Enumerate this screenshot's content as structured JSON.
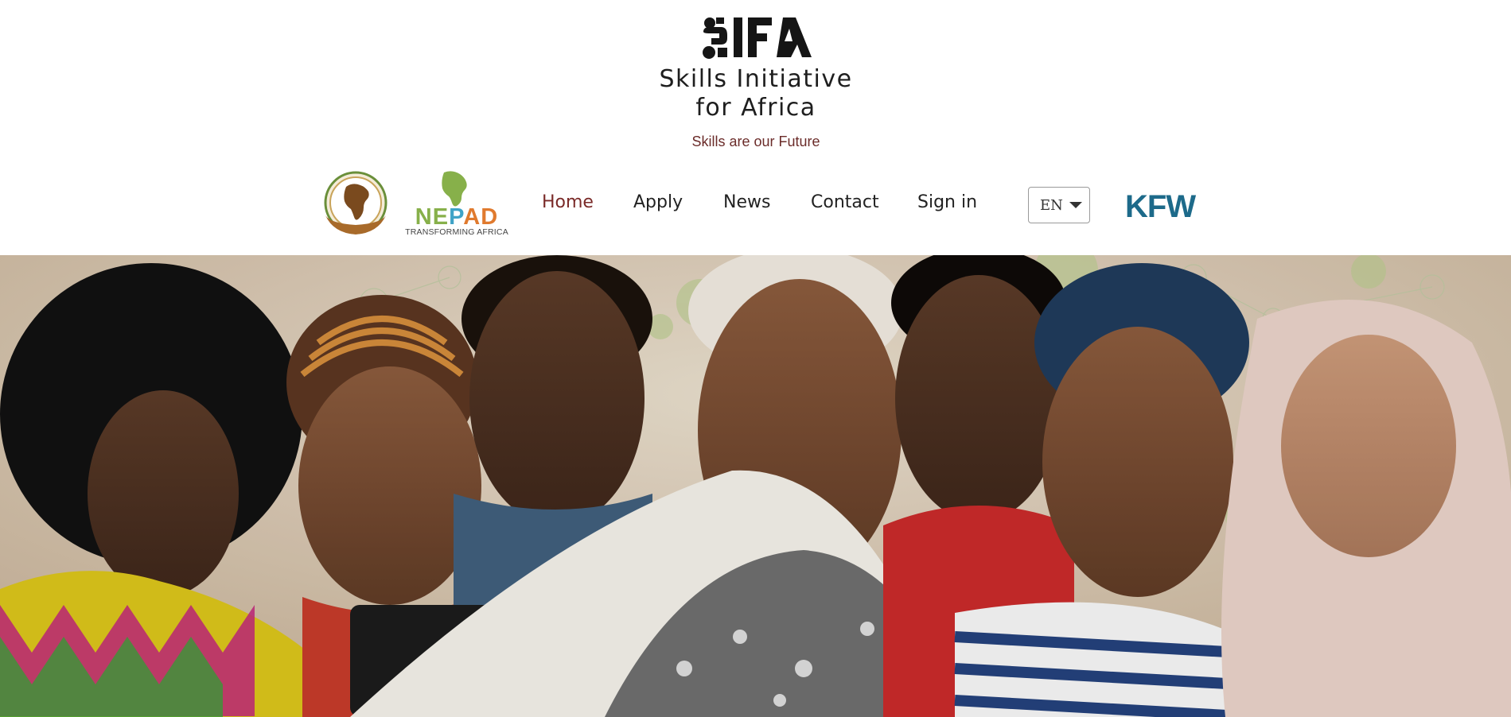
{
  "brand": {
    "logo_text": "SIFA",
    "title_line1": "Skills Initiative",
    "title_line2": "for Africa",
    "tagline": "Skills are our Future"
  },
  "partners": {
    "nepad_word": [
      "N",
      "E",
      "P",
      "A",
      "D"
    ],
    "nepad_sub": "TRANSFORMING AFRICA",
    "kfw": "KFW"
  },
  "nav": {
    "items": [
      {
        "label": "Home",
        "active": true
      },
      {
        "label": "Apply",
        "active": false
      },
      {
        "label": "News",
        "active": false
      },
      {
        "label": "Contact",
        "active": false
      },
      {
        "label": "Sign in",
        "active": false
      }
    ]
  },
  "language": {
    "selected": "EN"
  },
  "colors": {
    "nav_active": "#7a2a28",
    "tagline": "#6b2c2a",
    "kfw_blue": "#1d6a8a",
    "nepad_green": "#87b04a",
    "nepad_blue": "#3fa3c7",
    "nepad_orange": "#e07a2e"
  },
  "hero": {
    "image": "hero-photo-seven-young-africans"
  }
}
